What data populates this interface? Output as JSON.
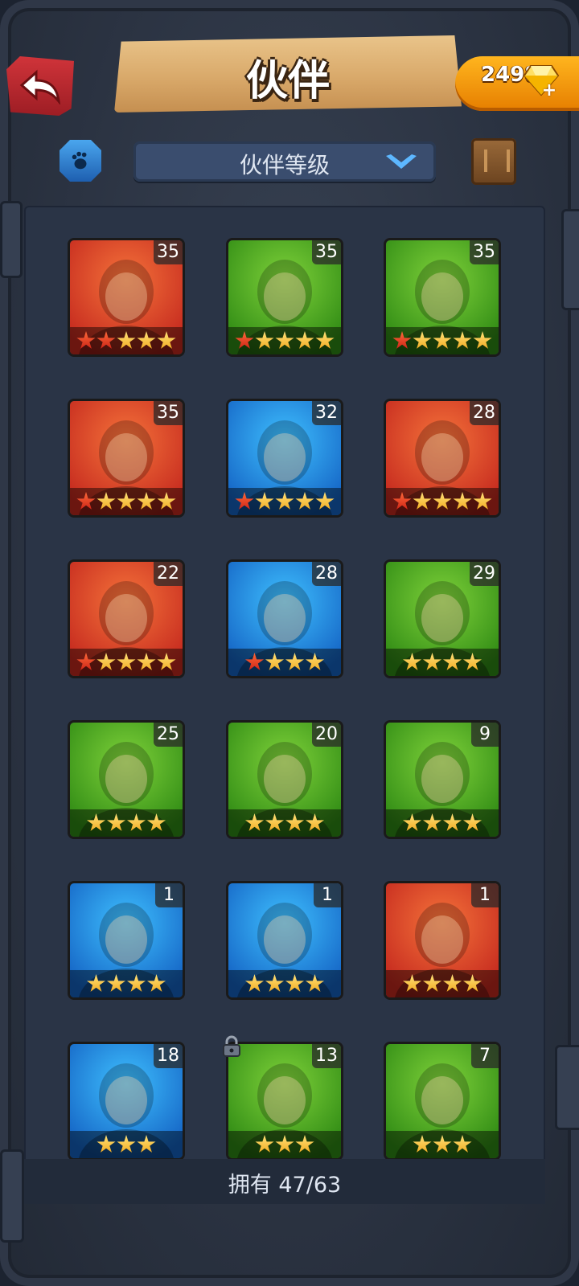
{
  "header": {
    "title": "伙伴",
    "gems": "2498",
    "gem_plus": "+"
  },
  "toolbar": {
    "sort_label": "伙伴等级"
  },
  "colors": {
    "red": "#d0343a",
    "green": "#3fa71a",
    "blue": "#1f8fe0",
    "gold": "#f1a81c"
  },
  "heroes": [
    {
      "level": "35",
      "bg": "red",
      "stars": 5,
      "red_stars": 2
    },
    {
      "level": "35",
      "bg": "green",
      "stars": 5,
      "red_stars": 1
    },
    {
      "level": "35",
      "bg": "green",
      "stars": 5,
      "red_stars": 1
    },
    {
      "level": "35",
      "bg": "red",
      "stars": 5,
      "red_stars": 1
    },
    {
      "level": "32",
      "bg": "blue",
      "stars": 5,
      "red_stars": 1
    },
    {
      "level": "28",
      "bg": "red",
      "stars": 5,
      "red_stars": 1
    },
    {
      "level": "22",
      "bg": "red",
      "stars": 5,
      "red_stars": 1
    },
    {
      "level": "28",
      "bg": "blue",
      "stars": 4,
      "red_stars": 1
    },
    {
      "level": "29",
      "bg": "green",
      "stars": 4,
      "red_stars": 0
    },
    {
      "level": "25",
      "bg": "green",
      "stars": 4,
      "red_stars": 0
    },
    {
      "level": "20",
      "bg": "green",
      "stars": 4,
      "red_stars": 0
    },
    {
      "level": "9",
      "bg": "green",
      "stars": 4,
      "red_stars": 0
    },
    {
      "level": "1",
      "bg": "blue",
      "stars": 4,
      "red_stars": 0
    },
    {
      "level": "1",
      "bg": "blue",
      "stars": 4,
      "red_stars": 0
    },
    {
      "level": "1",
      "bg": "red",
      "stars": 4,
      "red_stars": 0
    },
    {
      "level": "18",
      "bg": "blue",
      "stars": 3,
      "red_stars": 0
    },
    {
      "level": "13",
      "bg": "green",
      "stars": 3,
      "red_stars": 0,
      "locked": true
    },
    {
      "level": "7",
      "bg": "green",
      "stars": 3,
      "red_stars": 0
    }
  ],
  "footer": {
    "owned_text": "拥有 47/63"
  }
}
